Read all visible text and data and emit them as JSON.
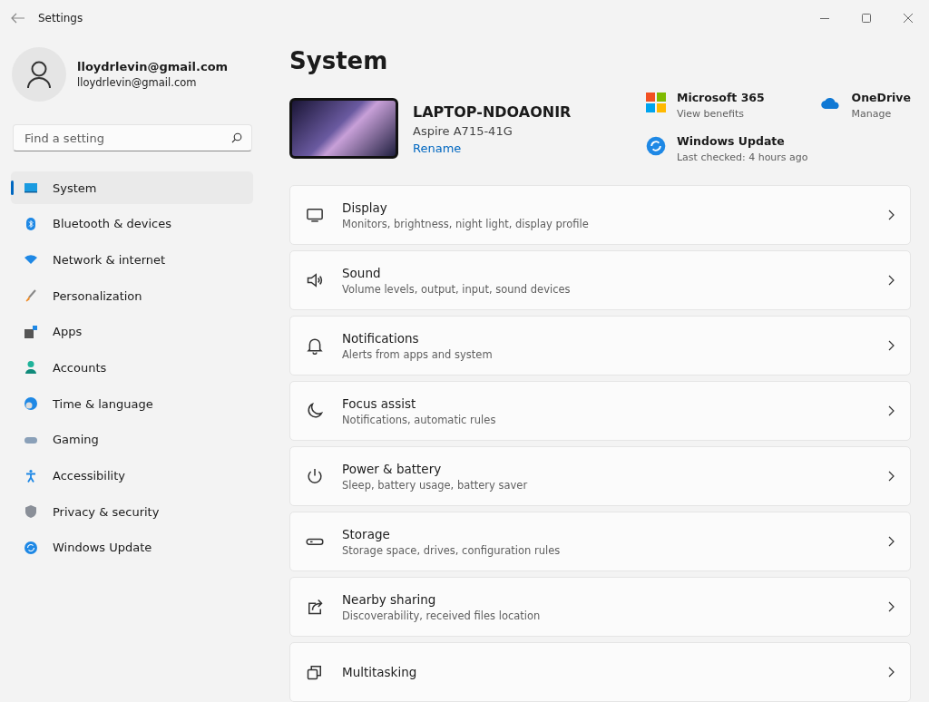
{
  "window": {
    "title": "Settings"
  },
  "account": {
    "name": "lloydrlevin@gmail.com",
    "email": "lloydrlevin@gmail.com"
  },
  "search": {
    "placeholder": "Find a setting"
  },
  "nav": [
    {
      "label": "System",
      "selected": true
    },
    {
      "label": "Bluetooth & devices",
      "selected": false
    },
    {
      "label": "Network & internet",
      "selected": false
    },
    {
      "label": "Personalization",
      "selected": false
    },
    {
      "label": "Apps",
      "selected": false
    },
    {
      "label": "Accounts",
      "selected": false
    },
    {
      "label": "Time & language",
      "selected": false
    },
    {
      "label": "Gaming",
      "selected": false
    },
    {
      "label": "Accessibility",
      "selected": false
    },
    {
      "label": "Privacy & security",
      "selected": false
    },
    {
      "label": "Windows Update",
      "selected": false
    }
  ],
  "page": {
    "title": "System"
  },
  "device": {
    "name": "LAPTOP-NDOAONIR",
    "model": "Aspire A715-41G",
    "rename": "Rename"
  },
  "quick_links": [
    {
      "title": "Microsoft 365",
      "subtitle": "View benefits"
    },
    {
      "title": "OneDrive",
      "subtitle": "Manage"
    },
    {
      "title": "Windows Update",
      "subtitle": "Last checked: 4 hours ago"
    }
  ],
  "settings": [
    {
      "title": "Display",
      "description": "Monitors, brightness, night light, display profile"
    },
    {
      "title": "Sound",
      "description": "Volume levels, output, input, sound devices"
    },
    {
      "title": "Notifications",
      "description": "Alerts from apps and system"
    },
    {
      "title": "Focus assist",
      "description": "Notifications, automatic rules"
    },
    {
      "title": "Power & battery",
      "description": "Sleep, battery usage, battery saver"
    },
    {
      "title": "Storage",
      "description": "Storage space, drives, configuration rules"
    },
    {
      "title": "Nearby sharing",
      "description": "Discoverability, received files location"
    },
    {
      "title": "Multitasking"
    }
  ]
}
